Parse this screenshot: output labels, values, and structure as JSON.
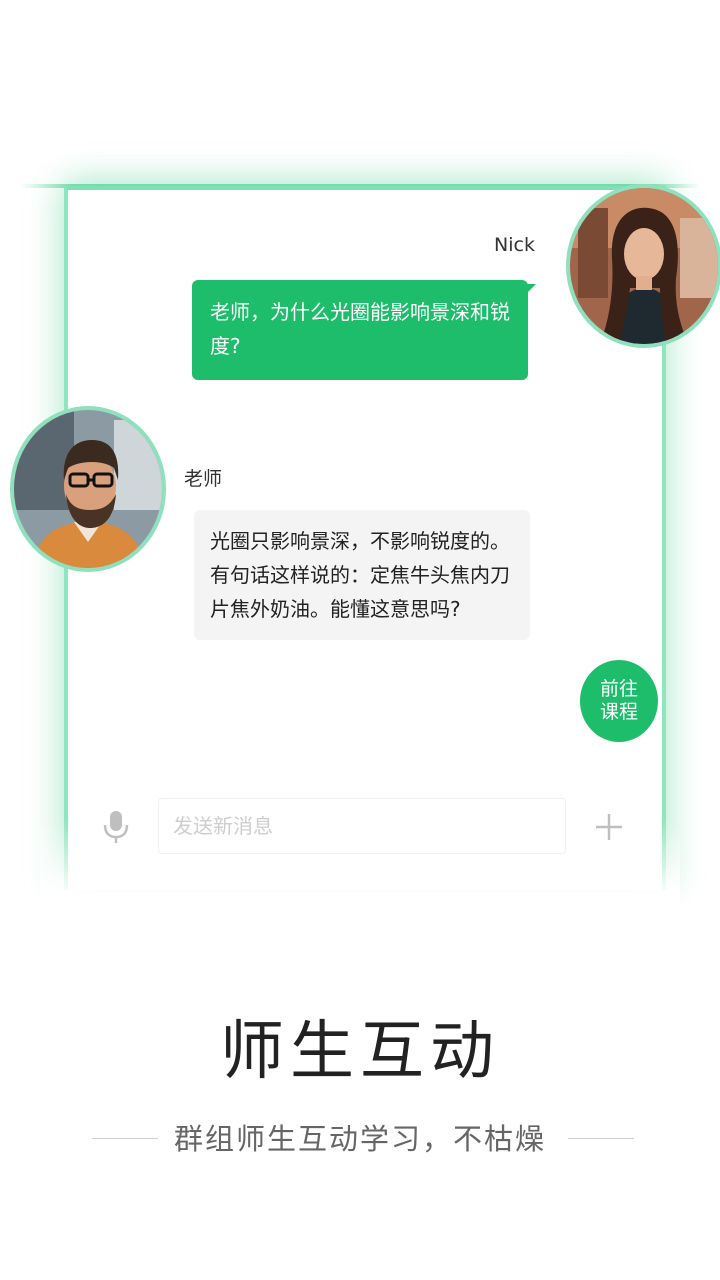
{
  "chat": {
    "nick": {
      "name": "Nick",
      "message": "老师，为什么光圈能影响景深和锐度?"
    },
    "teacher": {
      "name": "老师",
      "message": "光圈只影响景深，不影响锐度的。有句话这样说的：定焦牛头焦内刀片焦外奶油。能懂这意思吗?"
    },
    "goto_button": "前往课程",
    "input": {
      "placeholder": "发送新消息"
    },
    "icons": {
      "mic": "microphone-icon",
      "plus": "plus-icon"
    }
  },
  "intro": {
    "title": "师生互动",
    "subtitle": "群组师生互动学习，不枯燥"
  },
  "colors": {
    "accent": "#1dbd6c",
    "frame": "#8fe6bd",
    "bubble_gray": "#f4f4f4"
  }
}
